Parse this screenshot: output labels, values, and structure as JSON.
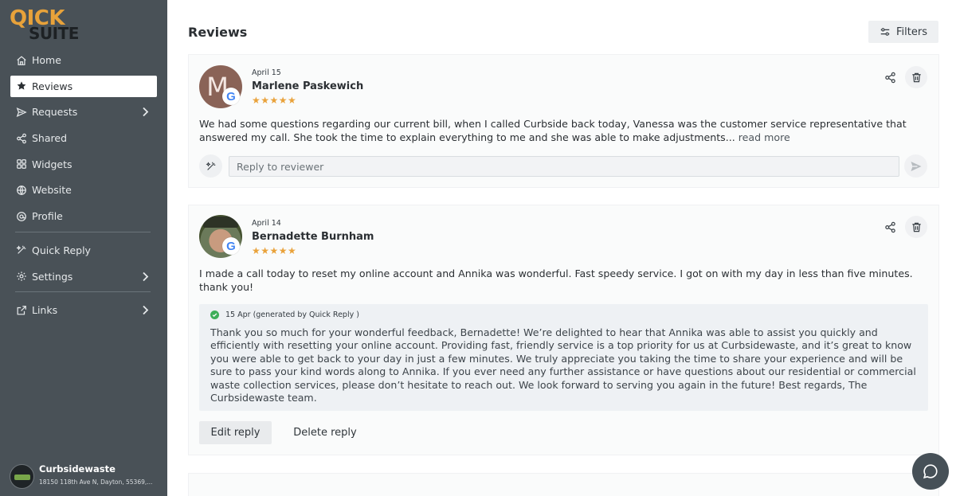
{
  "app": {
    "logo_top": "QICK",
    "logo_bottom": "SUITE"
  },
  "sidebar": {
    "items": [
      {
        "label": "Home",
        "icon": "home-icon"
      },
      {
        "label": "Reviews",
        "icon": "star-icon",
        "active": true
      },
      {
        "label": "Requests",
        "icon": "send-icon",
        "chevron": true
      },
      {
        "label": "Shared",
        "icon": "share-icon"
      },
      {
        "label": "Widgets",
        "icon": "widgets-icon"
      },
      {
        "label": "Website",
        "icon": "globe-icon"
      },
      {
        "label": "Profile",
        "icon": "profile-icon"
      },
      {
        "label": "Quick Reply",
        "icon": "magic-wand-icon"
      },
      {
        "label": "Settings",
        "icon": "gear-icon",
        "chevron": true
      },
      {
        "label": "Links",
        "icon": "external-link-icon",
        "chevron": true
      }
    ],
    "account": {
      "name": "Curbsidewaste",
      "address": "18150 118th Ave N, Dayton, 55369,..."
    }
  },
  "header": {
    "title": "Reviews",
    "filters_label": "Filters"
  },
  "reviews": [
    {
      "date": "April 15",
      "reviewer": "Marlene Paskewich",
      "avatar_initial": "M",
      "source": "G",
      "stars": "★★★★★",
      "rating": 5,
      "text": "We had some questions regarding our current bill, when I called Curbside back today, Vanessa was the customer service representative that answered my call. She took the time to explain everything to me and she was able to make adjustments...",
      "read_more": "read more",
      "reply_placeholder": "Reply to reviewer"
    },
    {
      "date": "April 14",
      "reviewer": "Bernadette Burnham",
      "source": "G",
      "stars": "★★★★★",
      "rating": 5,
      "text": "I made a call today to reset my online account and Annika was wonderful. Fast speedy service. I got on with my day in less than five minutes. thank you!",
      "generated_meta": "15 Apr (generated by Quick Reply )",
      "generated_reply": "Thank you so much for your wonderful feedback, Bernadette! We’re delighted to hear that Annika was able to assist you quickly and efficiently with resetting your online account. Providing fast, friendly service is a top priority for us at Curbsidewaste, and it’s great to know you were able to get back to your day in just a few minutes. We truly appreciate you taking the time to share your experience and will be sure to pass your kind words along to Annika. If you ever need any further assistance or have questions about our residential or commercial waste collection services, please don’t hesitate to reach out. We look forward to serving you again in the future! Best regards, The Curbsidewaste team.",
      "edit_label": "Edit reply",
      "delete_label": "Delete reply"
    }
  ],
  "colors": {
    "sidebar_bg": "#495157",
    "accent_orange": "#e8a23a",
    "star": "#e9a23b",
    "success": "#3fae5a"
  }
}
